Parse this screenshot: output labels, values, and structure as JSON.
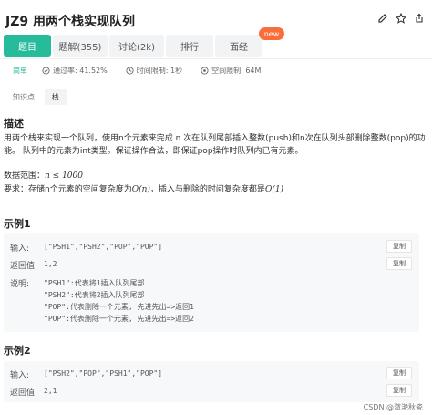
{
  "header": {
    "title": "JZ9  用两个栈实现队列"
  },
  "tabs": [
    {
      "label": "题目"
    },
    {
      "label": "题解(355)"
    },
    {
      "label": "讨论(2k)"
    },
    {
      "label": "排行"
    },
    {
      "label": "面经"
    }
  ],
  "new_badge": "new",
  "meta": {
    "difficulty": "简单",
    "pass_rate": "通过率: 41.52%",
    "time_limit": "时间限制: 1秒",
    "space_limit": "空间限制: 64M"
  },
  "knowledge": {
    "label": "知识点:",
    "tag": "栈"
  },
  "description": {
    "heading": "描述",
    "line1": "用两个栈来实现一个队列，使用n个元素来完成 n 次在队列尾部插入整数(push)和n次在队列头部删除整数(pop)的功",
    "line2": "能。 队列中的元素为int类型。保证操作合法，即保证pop操作时队列内已有元素。",
    "range_label": "数据范围：",
    "range_math": "n ≤ 1000",
    "req_text": "要求：存储n个元素的空间复杂度为",
    "req_space": "O(n)",
    "req_mid": "，插入与删除的时间复杂度都是",
    "req_time": "O(1)"
  },
  "examples": [
    {
      "heading": "示例1",
      "input_label": "输入:",
      "input_value": "[\"PSH1\",\"PSH2\",\"POP\",\"POP\"]",
      "output_label": "返回值:",
      "output_value": "1,2",
      "explain_label": "说明:",
      "explain_lines": [
        "\"PSH1\":代表将1插入队列尾部",
        "\"PSH2\":代表将2插入队列尾部",
        "\"POP\":代表删除一个元素, 先进先出=>返回1",
        "\"POP\":代表删除一个元素, 先进先出=>返回2"
      ],
      "copy_label": "复制"
    },
    {
      "heading": "示例2",
      "input_label": "输入:",
      "input_value": "[\"PSH2\",\"POP\",\"PSH1\",\"POP\"]",
      "output_label": "返回值:",
      "output_value": "2,1",
      "copy_label": "复制"
    }
  ],
  "watermark": "CSDN @潋滟秋瓷",
  "colors": {
    "accent": "#25bb9b",
    "badge": "#fa6e3c"
  }
}
